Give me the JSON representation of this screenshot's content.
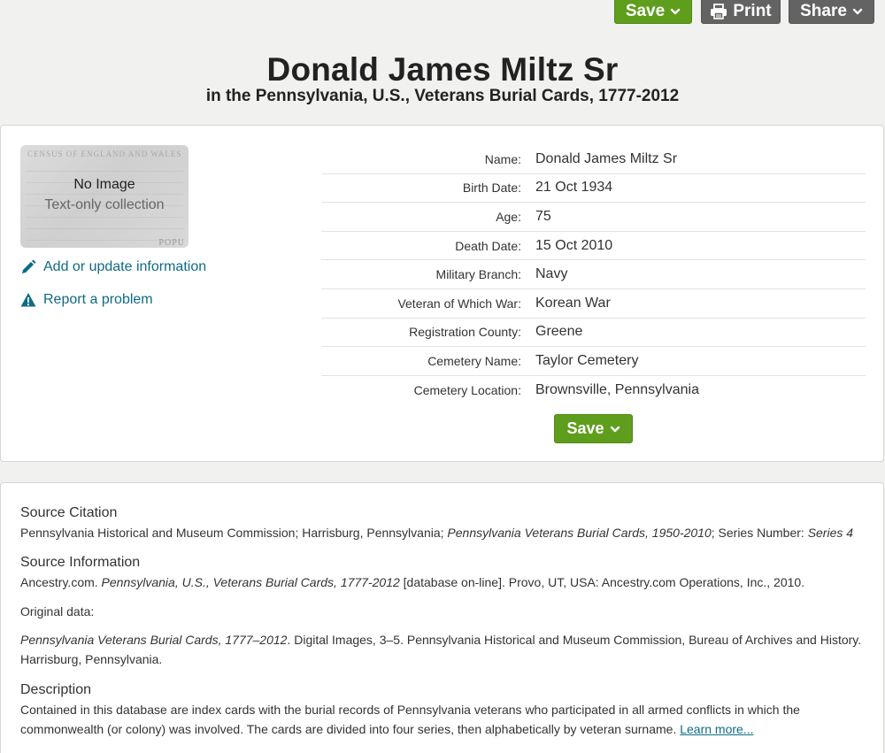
{
  "toolbar": {
    "save_label": "Save",
    "print_label": "Print",
    "share_label": "Share"
  },
  "header": {
    "title": "Donald James Miltz Sr",
    "subtitle": "in the Pennsylvania, U.S., Veterans Burial Cards, 1777-2012"
  },
  "image_placeholder": {
    "title": "No Image",
    "subtitle": "Text-only collection",
    "background_text": "CENSUS OF ENGLAND AND WALES",
    "background_corner": "POPU"
  },
  "actions": {
    "add_update": "Add or update information",
    "report": "Report a problem"
  },
  "facts": [
    {
      "label": "Name:",
      "value": "Donald James Miltz Sr"
    },
    {
      "label": "Birth Date:",
      "value": "21 Oct 1934"
    },
    {
      "label": "Age:",
      "value": "75"
    },
    {
      "label": "Death Date:",
      "value": "15 Oct 2010"
    },
    {
      "label": "Military Branch:",
      "value": "Navy"
    },
    {
      "label": "Veteran of Which War:",
      "value": "Korean War"
    },
    {
      "label": "Registration County:",
      "value": "Greene"
    },
    {
      "label": "Cemetery Name:",
      "value": "Taylor Cemetery"
    },
    {
      "label": "Cemetery Location:",
      "value": "Brownsville, Pennsylvania"
    }
  ],
  "card_save_label": "Save",
  "source": {
    "citation_heading": "Source Citation",
    "citation_pre": "Pennsylvania Historical and Museum Commission; Harrisburg, Pennsylvania; ",
    "citation_italic": "Pennsylvania Veterans Burial Cards, 1950-2010",
    "citation_mid": "; Series Number: ",
    "citation_italic2": "Series 4",
    "info_heading": "Source Information",
    "info_pre": "Ancestry.com. ",
    "info_italic": "Pennsylvania, U.S., Veterans Burial Cards, 1777-2012",
    "info_post": " [database on-line]. Provo, UT, USA: Ancestry.com Operations, Inc., 2010.",
    "original_label": "Original data:",
    "original_italic": "Pennsylvania Veterans Burial Cards, 1777–2012",
    "original_post": ". Digital Images, 3–5. Pennsylvania Historical and Museum Commission, Bureau of Archives and History. Harrisburg, Pennsylvania.",
    "description_heading": "Description",
    "description_text": "Contained in this database are index cards with the burial records of Pennsylvania veterans who participated in all armed conflicts in which the commonwealth (or colony) was involved. The cards are divided into four series, then alphabetically by veteran surname. ",
    "learn_more": "Learn more..."
  },
  "colors": {
    "save_green": "#5f9e1c",
    "dark_button": "#636363",
    "link_blue": "#0e6b85"
  }
}
